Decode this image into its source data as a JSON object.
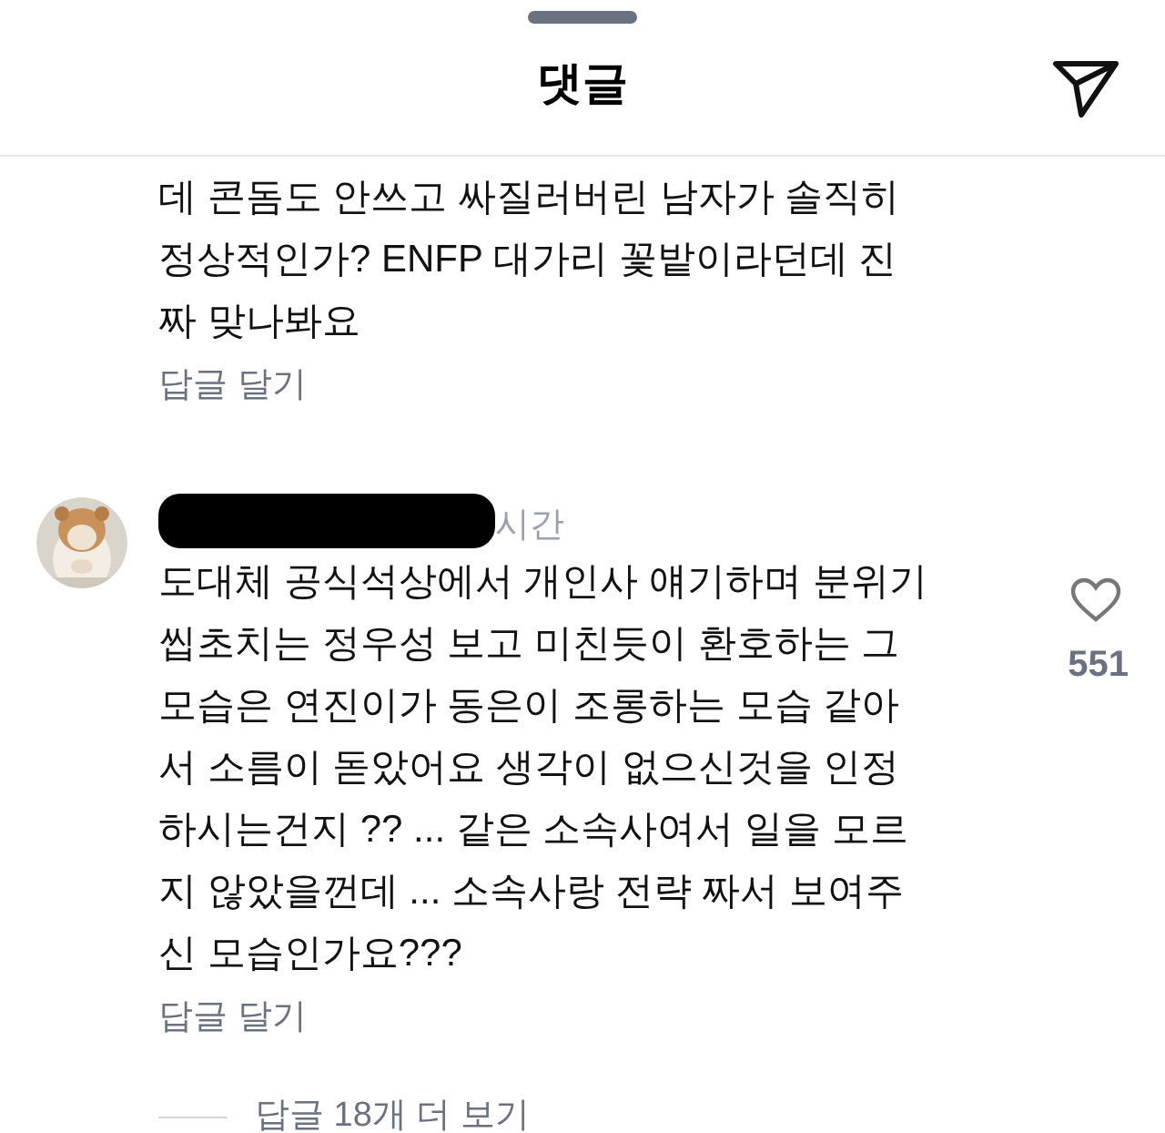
{
  "header": {
    "title": "댓글"
  },
  "comments": [
    {
      "lines": [
        "데 콘돔도 안쓰고 싸질러버린 남자가 솔직히",
        "정상적인가? ENFP 대가리 꽃밭이라던데 진",
        "짜 맞나봐요"
      ],
      "reply_label": "답글 달기"
    },
    {
      "username_redacted": true,
      "time": "시간",
      "lines": [
        "도대체 공식석상에서 개인사 얘기하며 분위기",
        "씹초치는 정우성 보고 미친듯이 환호하는 그",
        "모습은 연진이가 동은이 조롱하는 모습 같아",
        "서 소름이 돋았어요 생각이 없으신것을 인정",
        "하시는건지 ?? ... 같은 소속사여서 일을 모르",
        "지 않았을껀데 ... 소속사랑 전략 짜서 보여주",
        "신 모습인가요???"
      ],
      "likes": "551",
      "liked": false,
      "reply_label": "답글 달기",
      "more_replies": "답글 18개 더 보기"
    }
  ]
}
